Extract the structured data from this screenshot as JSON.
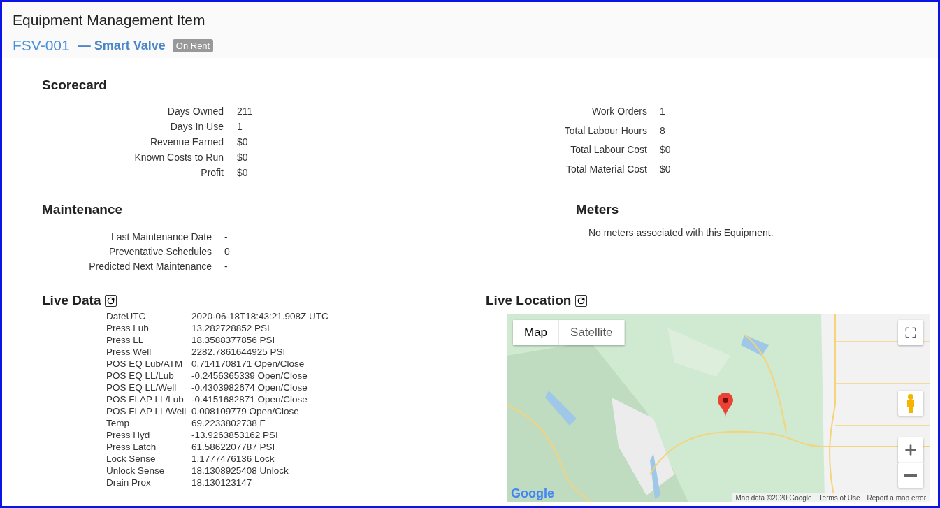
{
  "page": {
    "title": "Equipment Management Item",
    "code": "FSV-001",
    "name": "— Smart Valve",
    "status": "On Rent"
  },
  "scorecard": {
    "title": "Scorecard",
    "left": [
      {
        "label": "Days Owned",
        "value": "211"
      },
      {
        "label": "Days In Use",
        "value": "1"
      },
      {
        "label": "Revenue Earned",
        "value": "$0"
      },
      {
        "label": "Known Costs to Run",
        "value": "$0"
      },
      {
        "label": "Profit",
        "value": "$0"
      }
    ],
    "right": [
      {
        "label": "Work Orders",
        "value": "1"
      },
      {
        "label": "Total Labour Hours",
        "value": "8"
      },
      {
        "label": "Total Labour Cost",
        "value": "$0"
      },
      {
        "label": "Total Material Cost",
        "value": "$0"
      }
    ]
  },
  "maintenance": {
    "title": "Maintenance",
    "rows": [
      {
        "label": "Last Maintenance Date",
        "value": "-"
      },
      {
        "label": "Preventative Schedules",
        "value": "0"
      },
      {
        "label": "Predicted Next Maintenance",
        "value": "-"
      }
    ]
  },
  "meters": {
    "title": "Meters",
    "message": "No meters associated with this Equipment."
  },
  "live_data": {
    "title": "Live Data",
    "rows": [
      {
        "label": "DateUTC",
        "value": "2020-06-18T18:43:21.908Z UTC"
      },
      {
        "label": "Press Lub",
        "value": "13.282728852 PSI"
      },
      {
        "label": "Press LL",
        "value": "18.3588377856 PSI"
      },
      {
        "label": "Press Well",
        "value": "2282.7861644925 PSI"
      },
      {
        "label": "POS EQ Lub/ATM",
        "value": "0.7141708171 Open/Close"
      },
      {
        "label": "POS EQ LL/Lub",
        "value": "-0.2456365339 Open/Close"
      },
      {
        "label": "POS EQ LL/Well",
        "value": "-0.4303982674 Open/Close"
      },
      {
        "label": "POS FLAP LL/Lub",
        "value": "-0.4151682871 Open/Close"
      },
      {
        "label": "POS FLAP LL/Well",
        "value": "0.008109779 Open/Close"
      },
      {
        "label": "Temp",
        "value": "69.2233802738 F"
      },
      {
        "label": "Press Hyd",
        "value": "-13.9263853162 PSI"
      },
      {
        "label": "Press Latch",
        "value": "61.5862207787 PSI"
      },
      {
        "label": "Lock Sense",
        "value": "1.1777476136 Lock"
      },
      {
        "label": "Unlock Sense",
        "value": "18.1308925408 Unlock"
      },
      {
        "label": "Drain Prox",
        "value": "18.130123147"
      }
    ]
  },
  "live_location": {
    "title": "Live Location",
    "map_types": [
      {
        "label": "Map",
        "selected": true
      },
      {
        "label": "Satellite",
        "selected": false
      }
    ],
    "logo": "Google",
    "attribution": [
      "Map data ©2020 Google",
      "Terms of Use",
      "Report a map error"
    ]
  }
}
